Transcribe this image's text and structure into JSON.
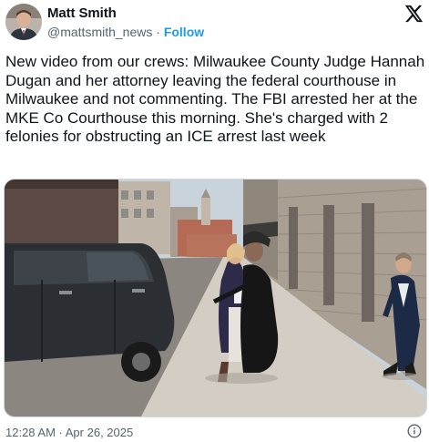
{
  "author": {
    "name": "Matt Smith",
    "handle": "@mattsmith_news",
    "separator": " · ",
    "follow_label": "Follow"
  },
  "tweet": {
    "text": "New video from our crews: Milwaukee County Judge Hannah Dugan and her attorney leaving the federal courthouse in Milwaukee and not commenting. The FBI arrested her at the MKE Co Courthouse this morning. She's charged with 2 felonies for obstructing an ICE arrest last week",
    "timestamp": "12:28 AM · Apr 26, 2025"
  },
  "icons": {
    "platform_logo": "x-logo-icon",
    "info": "info-icon",
    "avatar": "avatar"
  },
  "colors": {
    "link": "#1d9bf0",
    "muted": "#536471",
    "text": "#0f1419"
  }
}
